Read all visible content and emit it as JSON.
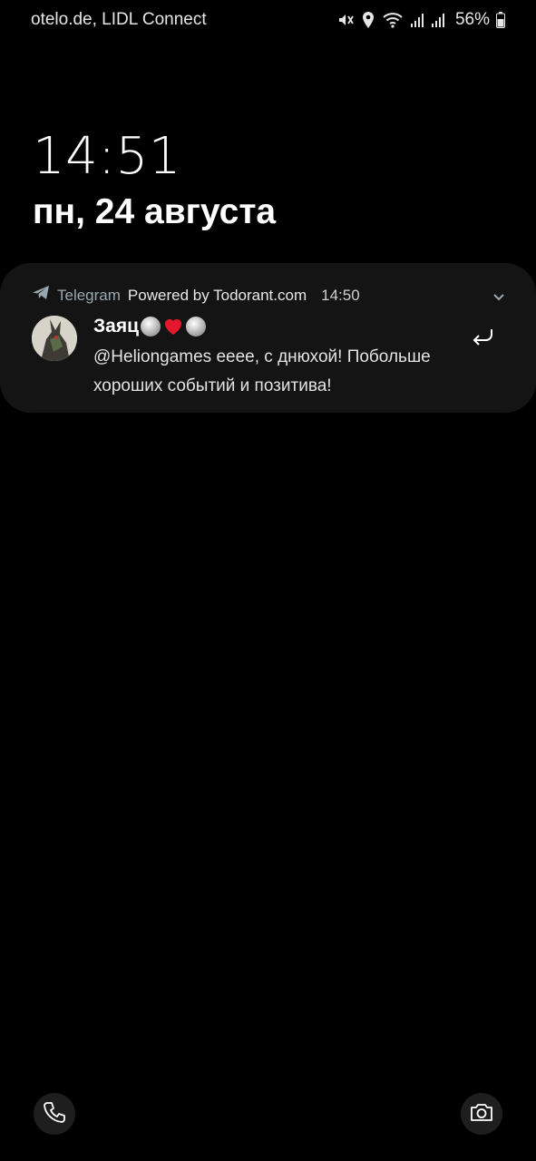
{
  "status_bar": {
    "carrier": "otelo.de, LIDL Connect",
    "battery_percent": "56%",
    "icons": [
      "mute-icon",
      "location-icon",
      "wifi-icon",
      "signal-icon",
      "signal-icon-2",
      "battery-icon"
    ]
  },
  "lock_screen": {
    "time": "14:51",
    "date": "пн, 24 августа"
  },
  "notification": {
    "app_name": "Telegram",
    "sub_text": "Powered by Todorant.com",
    "time": "14:50",
    "sender": "Заяц",
    "message": "@Heliongames eeee, с днюхой! Побольше хороших событий и позитива!",
    "icons": [
      "telegram-icon",
      "chevron-down-icon",
      "reply-icon"
    ],
    "accent_color": "#9aa8b0",
    "background_color": "#141414"
  },
  "bottom_shortcuts": {
    "left": "phone-icon",
    "right": "camera-icon"
  }
}
